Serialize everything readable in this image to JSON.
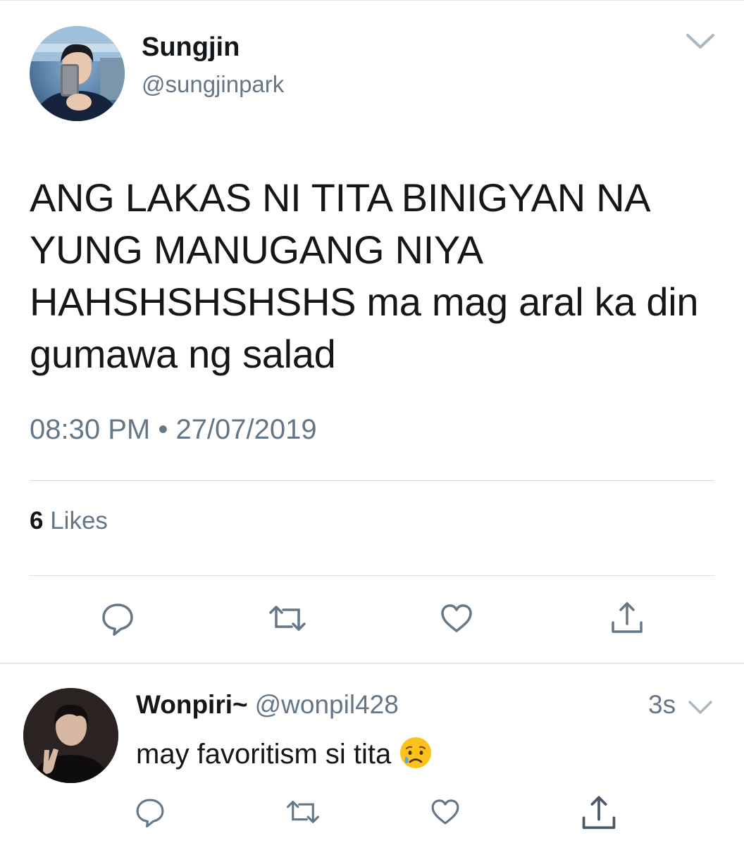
{
  "main_tweet": {
    "display_name": "Sungjin",
    "handle": "@sungjinpark",
    "text": "ANG LAKAS NI TITA BINIGYAN NA YUNG MANUGANG NIYA HAHSHSHSHSHS ma mag aral ka din gumawa ng salad",
    "timestamp": "08:30 PM • 27/07/2019",
    "likes_count": "6",
    "likes_label": "Likes",
    "actions": [
      "reply-icon",
      "retweet-icon",
      "like-icon",
      "share-icon"
    ]
  },
  "reply": {
    "display_name": "Wonpiri~",
    "handle": "@wonpil428",
    "time": "3s",
    "text": "may favoritism si tita",
    "emoji": "crying-face-emoji",
    "actions": [
      "reply-icon",
      "retweet-icon",
      "like-icon",
      "share-icon"
    ]
  },
  "colors": {
    "text_primary": "#14171a",
    "text_secondary": "#657786",
    "icon": "#657786",
    "divider": "#e1e8ed"
  }
}
